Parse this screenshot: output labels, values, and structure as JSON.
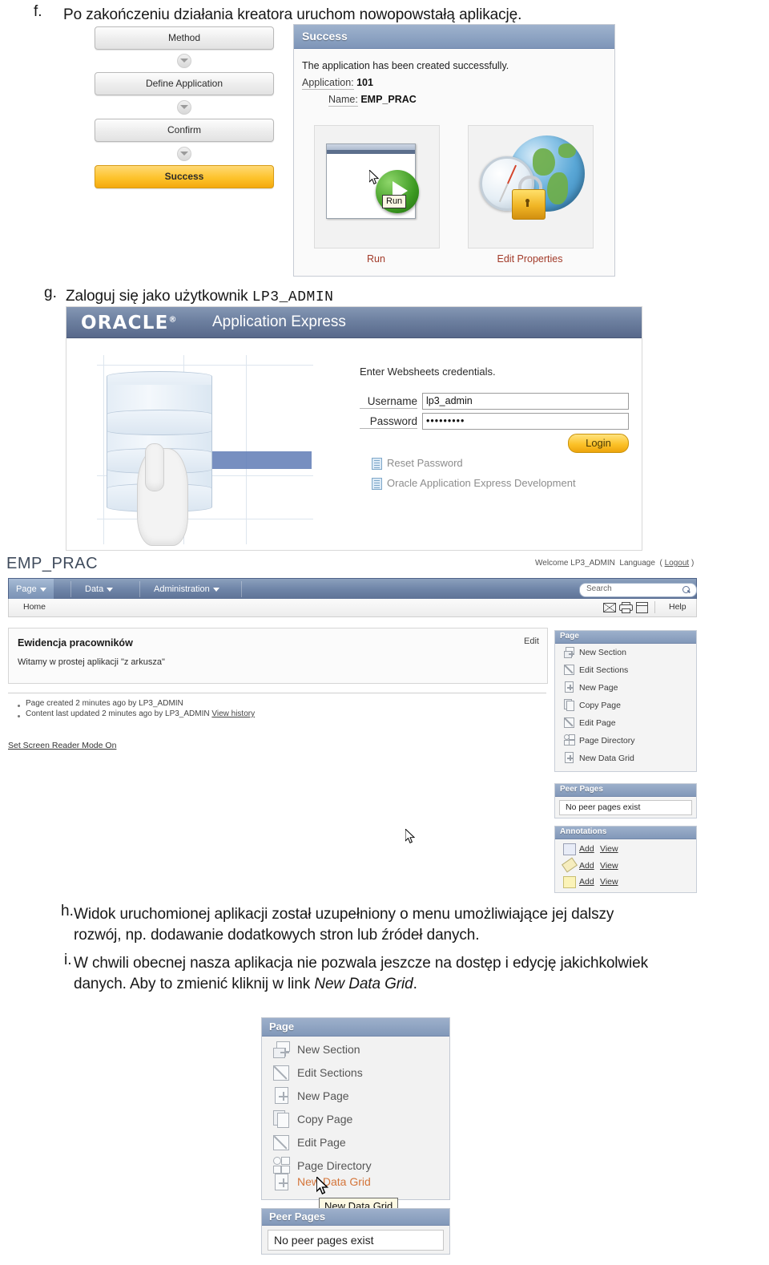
{
  "document": {
    "items": [
      {
        "marker": "f.",
        "text": "Po zakończeniu działania kreatora uruchom nowopowstałą aplikację."
      },
      {
        "marker": "g.",
        "text_before": "Zaloguj się jako użytkownik ",
        "mono": "LP3_ADMIN"
      },
      {
        "marker": "h.",
        "line1": "Widok uruchomionej aplikacji został uzupełniony o menu umożliwiające jej dalszy",
        "line2": "rozwój, np. dodawanie dodatkowych stron lub źródeł danych."
      },
      {
        "marker": "i.",
        "line1": "W chwili obecnej nasza aplikacja nie pozwala jeszcze na dostęp i edycję jakichkolwiek",
        "line2_before": "danych. Aby to zmienić kliknij w link ",
        "line2_italic": "New Data Grid",
        "line2_after": "."
      }
    ]
  },
  "wizard": {
    "steps": [
      {
        "label": "Method",
        "active": false
      },
      {
        "label": "Define Application",
        "active": false
      },
      {
        "label": "Confirm",
        "active": false
      },
      {
        "label": "Success",
        "active": true
      }
    ]
  },
  "success_panel": {
    "header": "Success",
    "message": "The application has been created successfully.",
    "application_label": "Application:",
    "application_value": "101",
    "name_label": "Name:",
    "name_value": "EMP_PRAC",
    "cards": [
      {
        "caption": "Run",
        "icon": "run-play-icon",
        "tooltip": "Run"
      },
      {
        "caption": "Edit Properties",
        "icon": "globe-lock-icon"
      }
    ]
  },
  "login": {
    "brand": "ORACLE",
    "brand_mark": "®",
    "product": "Application Express",
    "hint": "Enter Websheets credentials.",
    "username_label": "Username",
    "username_value": "lp3_admin",
    "password_label": "Password",
    "password_value": "•••••••••",
    "login_button": "Login",
    "links": [
      {
        "label": "Reset Password",
        "icon": "document-icon"
      },
      {
        "label": "Oracle Application Express Development",
        "icon": "document-icon"
      }
    ]
  },
  "app": {
    "title": "EMP_PRAC",
    "welcome": "Welcome LP3_ADMIN",
    "language": "Language",
    "logout": "Logout",
    "nav": [
      {
        "label": "Page",
        "selected": true
      },
      {
        "label": "Data",
        "selected": false
      },
      {
        "label": "Administration",
        "selected": false
      }
    ],
    "search_placeholder": "Search",
    "breadcrumb": "Home",
    "help": "Help",
    "toolbar_icons": [
      "mail-icon",
      "print-icon",
      "window-icon"
    ],
    "region_title": "Ewidencja pracowników",
    "region_text": "Witamy w prostej aplikacji \"z arkusza\"",
    "edit_link": "Edit",
    "meta": [
      "Page created 2 minutes ago by LP3_ADMIN",
      "Content last updated 2 minutes ago by LP3_ADMIN"
    ],
    "view_history": "View history",
    "screen_reader": "Set Screen Reader Mode On",
    "panels": {
      "page": {
        "title": "Page",
        "items": [
          {
            "label": "New Section",
            "icon": "new-section-icon"
          },
          {
            "label": "Edit Sections",
            "icon": "edit-sections-icon"
          },
          {
            "label": "New Page",
            "icon": "new-page-icon"
          },
          {
            "label": "Copy Page",
            "icon": "copy-page-icon"
          },
          {
            "label": "Edit Page",
            "icon": "edit-page-icon"
          },
          {
            "label": "Page Directory",
            "icon": "page-directory-icon"
          },
          {
            "label": "New Data Grid",
            "icon": "new-data-grid-icon"
          }
        ]
      },
      "peer": {
        "title": "Peer Pages",
        "empty": "No peer pages exist"
      },
      "annotations": {
        "title": "Annotations",
        "rows": [
          {
            "add": "Add",
            "view": "View",
            "icon": "note-edit-icon"
          },
          {
            "add": "Add",
            "view": "View",
            "icon": "tag-icon"
          },
          {
            "add": "Add",
            "view": "View",
            "icon": "sticky-note-icon"
          }
        ]
      }
    }
  },
  "bottom_panel": {
    "page": {
      "title": "Page",
      "items": [
        {
          "label": "New Section",
          "icon": "new-section-icon",
          "highlighted": false
        },
        {
          "label": "Edit Sections",
          "icon": "edit-sections-icon",
          "highlighted": false
        },
        {
          "label": "New Page",
          "icon": "new-page-icon",
          "highlighted": false
        },
        {
          "label": "Copy Page",
          "icon": "copy-page-icon",
          "highlighted": false
        },
        {
          "label": "Edit Page",
          "icon": "edit-page-icon",
          "highlighted": false
        },
        {
          "label": "Page Directory",
          "icon": "page-directory-icon",
          "highlighted": false
        },
        {
          "label": "New Data Grid",
          "icon": "new-data-grid-icon",
          "highlighted": true
        }
      ]
    },
    "tooltip": "New Data Grid",
    "peer": {
      "title": "Peer Pages",
      "empty": "No peer pages exist"
    }
  },
  "colors": {
    "accent_blue": "#7e95b8",
    "highlight_orange": "#d4753a",
    "active_yellow": "#fdc32c",
    "link_red": "#a23b2a"
  }
}
